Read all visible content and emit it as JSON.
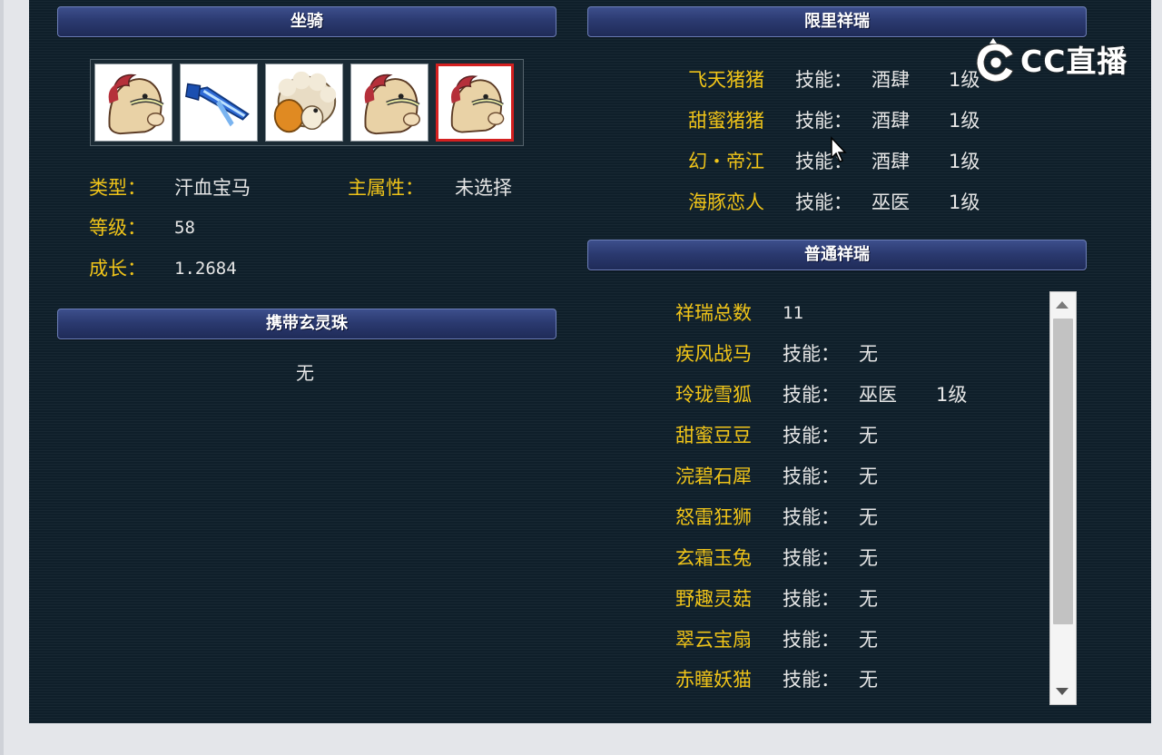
{
  "mount": {
    "header": "坐骑",
    "type_label": "类型：",
    "type_value": "汗血宝马",
    "main_attr_label": "主属性：",
    "main_attr_value": "未选择",
    "level_label": "等级：",
    "level_value": "58",
    "growth_label": "成长：",
    "growth_value": "1.2684",
    "thumbnails": [
      {
        "icon": "horse-mount-icon",
        "selected": false
      },
      {
        "icon": "blue-sword-mount-icon",
        "selected": false
      },
      {
        "icon": "sheep-mount-icon",
        "selected": false
      },
      {
        "icon": "horse-mount-icon",
        "selected": false
      },
      {
        "icon": "horse-mount-icon",
        "selected": true
      }
    ]
  },
  "orbs": {
    "header": "携带玄灵珠",
    "value": "无"
  },
  "limited": {
    "header": "限里祥瑞",
    "items": [
      {
        "name": "飞天猪猪",
        "skill_label": "技能：",
        "skill": "酒肆",
        "level": "1级"
      },
      {
        "name": "甜蜜猪猪",
        "skill_label": "技能：",
        "skill": "酒肆",
        "level": "1级"
      },
      {
        "name": "幻・帝江",
        "skill_label": "技能：",
        "skill": "酒肆",
        "level": "1级"
      },
      {
        "name": "海豚恋人",
        "skill_label": "技能：",
        "skill": "巫医",
        "level": "1级"
      }
    ]
  },
  "normal": {
    "header": "普通祥瑞",
    "total_label": "祥瑞总数",
    "total_value": "11",
    "items": [
      {
        "name": "疾风战马",
        "skill_label": "技能：",
        "skill": "无",
        "level": ""
      },
      {
        "name": "玲珑雪狐",
        "skill_label": "技能：",
        "skill": "巫医",
        "level": "1级"
      },
      {
        "name": "甜蜜豆豆",
        "skill_label": "技能：",
        "skill": "无",
        "level": ""
      },
      {
        "name": "浣碧石犀",
        "skill_label": "技能：",
        "skill": "无",
        "level": ""
      },
      {
        "name": "怒雷狂狮",
        "skill_label": "技能：",
        "skill": "无",
        "level": ""
      },
      {
        "name": "玄霜玉兔",
        "skill_label": "技能：",
        "skill": "无",
        "level": ""
      },
      {
        "name": "野趣灵菇",
        "skill_label": "技能：",
        "skill": "无",
        "level": ""
      },
      {
        "name": "翠云宝扇",
        "skill_label": "技能：",
        "skill": "无",
        "level": ""
      },
      {
        "name": "赤瞳妖猫",
        "skill_label": "技能：",
        "skill": "无",
        "level": ""
      }
    ]
  },
  "watermark": {
    "text": "CC直播",
    "icon": "cc-live-logo-icon"
  },
  "colors": {
    "label": "#f0c419",
    "value": "#e6e6e6",
    "panel": "#0f1f2a",
    "header": "#2b3a70",
    "selected": "#d32020"
  }
}
